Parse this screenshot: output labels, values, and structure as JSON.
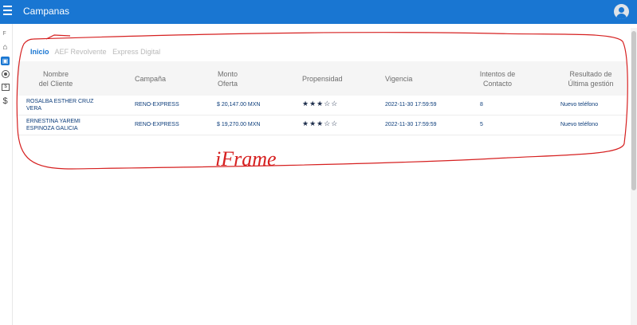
{
  "app": {
    "title": "Campanas"
  },
  "sidebar": {
    "letter": "F"
  },
  "tabs": [
    "Inicio",
    "AEF Revolvente",
    "Express Digital"
  ],
  "table": {
    "headers": [
      [
        "Nombre",
        "del Cliente"
      ],
      [
        "Campaña",
        ""
      ],
      [
        "Monto",
        "Oferta"
      ],
      [
        "Propensidad",
        ""
      ],
      [
        "Vigencia",
        ""
      ],
      [
        "Intentos de",
        "Contacto"
      ],
      [
        "Resultado de",
        "Última gestión"
      ]
    ],
    "rows": [
      {
        "name1": "ROSALBA ESTHER CRUZ",
        "name2": "VERA",
        "campaign": "RENO-EXPRESS",
        "amount": "$ 20,147.00 MXN",
        "stars": "★★★☆☆",
        "vigencia": "2022-11-30 17:59:59",
        "intentos": "8",
        "resultado": "Nuevo teléfono"
      },
      {
        "name1": "ERNESTINA YAREMI",
        "name2": "ESPINOZA GALICIA",
        "campaign": "RENO-EXPRESS",
        "amount": "$ 19,270.00 MXN",
        "stars": "★★★☆☆",
        "vigencia": "2022-11-30 17:59:59",
        "intentos": "5",
        "resultado": "Nuevo teléfono"
      }
    ]
  },
  "annotation": {
    "text": "iFrame",
    "color": "#d62020"
  }
}
